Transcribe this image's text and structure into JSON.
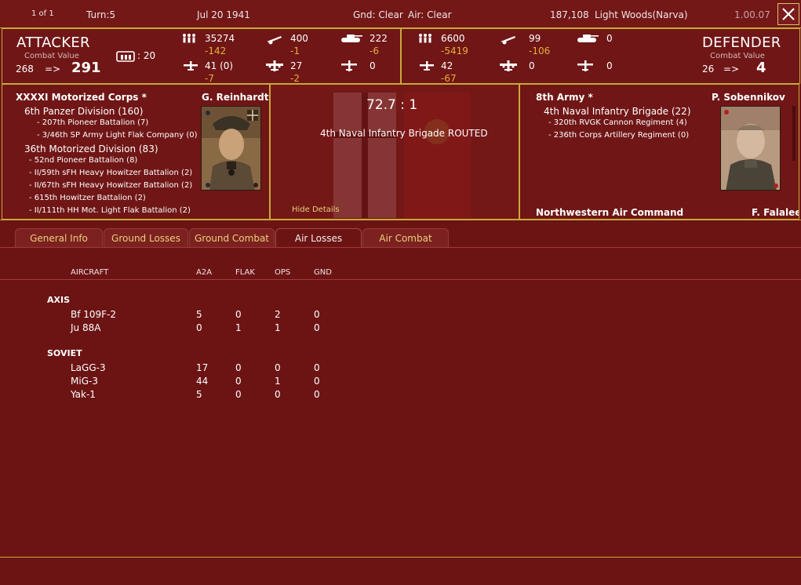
{
  "topbar": {
    "page": "1 of 1",
    "turn": "Turn:5",
    "date": "Jul 20 1941",
    "gnd": "Gnd: Clear",
    "air": "Air: Clear",
    "count": "187,108",
    "terrain": "Light Woods(Narva)",
    "version": "1.00.07"
  },
  "attacker": {
    "title": "ATTACKER",
    "cv_label": "Combat Value",
    "cv_from": "268",
    "arrow": "=>",
    "cv_to": "291",
    "fort": ": 20",
    "men": "35274",
    "men_loss": "-142",
    "guns": "400",
    "guns_loss": "-1",
    "afv": "222",
    "afv_loss": "-6",
    "fighters": "41 (0)",
    "fighters_loss": "-7",
    "bombers": "27",
    "bombers_loss": "-2",
    "recon": "0"
  },
  "defender": {
    "title": "DEFENDER",
    "cv_label": "Combat Value",
    "cv_from": "26",
    "arrow": "=>",
    "cv_to": "4",
    "men": "6600",
    "men_loss": "-5419",
    "guns": "99",
    "guns_loss": "-106",
    "afv": "0",
    "fighters": "42",
    "fighters_loss": "-67",
    "bombers": "0",
    "recon": "0"
  },
  "attacker_units": {
    "hq": "XXXXI Motorized Corps *",
    "commander": "G. Reinhardt",
    "lines": [
      "6th Panzer Division (160)",
      "- 207th Pioneer Battalion (7)",
      "- 3/46th SP Army Light Flak Company (0)",
      "36th Motorized Division (83)",
      "- 52nd Pioneer Battalion (8)",
      "- II/59th sFH Heavy Howitzer Battalion (2)",
      "- II/67th sFH Heavy Howitzer Battalion (2)",
      "- 615th Howitzer Battalion (2)",
      "- II/111th HH Mot. Light Flak Battalion (2)"
    ]
  },
  "result": {
    "ratio": "72.7 : 1",
    "message": "4th Naval Infantry Brigade ROUTED",
    "hide": "Hide Details"
  },
  "defender_units": {
    "hq": "8th Army *",
    "commander": "P. Sobennikov",
    "lines": [
      "4th Naval Infantry Brigade (22)",
      "- 320th RVGK Cannon Regiment (4)",
      "- 236th Corps Artillery Regiment (0)"
    ],
    "air_hq": "Northwestern Air Command",
    "air_commander": "F. Falaleev"
  },
  "tabs": [
    "General Info",
    "Ground Losses",
    "Ground Combat",
    "Air Losses",
    "Air Combat"
  ],
  "active_tab": "Air Losses",
  "table": {
    "headers": [
      "AIRCRAFT",
      "A2A",
      "FLAK",
      "OPS",
      "GND"
    ],
    "sections": [
      {
        "name": "AXIS",
        "rows": [
          {
            "aircraft": "Bf 109F-2",
            "a2a": "5",
            "flak": "0",
            "ops": "2",
            "gnd": "0"
          },
          {
            "aircraft": "Ju 88A",
            "a2a": "0",
            "flak": "1",
            "ops": "1",
            "gnd": "0"
          }
        ]
      },
      {
        "name": "SOVIET",
        "rows": [
          {
            "aircraft": "LaGG-3",
            "a2a": "17",
            "flak": "0",
            "ops": "0",
            "gnd": "0"
          },
          {
            "aircraft": "MiG-3",
            "a2a": "44",
            "flak": "0",
            "ops": "1",
            "gnd": "0"
          },
          {
            "aircraft": "Yak-1",
            "a2a": "5",
            "flak": "0",
            "ops": "0",
            "gnd": "0"
          }
        ]
      }
    ]
  },
  "colors": {
    "background": "#6c1414",
    "border": "#c9a93a",
    "loss": "#e6b03a",
    "tab_text": "#e8d27a"
  }
}
